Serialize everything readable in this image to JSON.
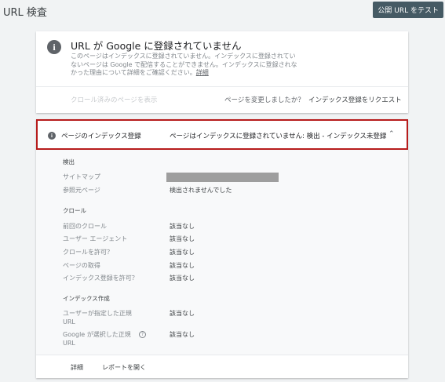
{
  "header": {
    "title": "URL 検査",
    "test_live_url_label": "公開 URL をテスト"
  },
  "status_card": {
    "title": "URL が Google に登録されていません",
    "desc_line1": "このページはインデックスに登録されていません。インデックスに登録されてい",
    "desc_line2": "ないページは Google で配信することができません。インデックスに登録されな",
    "desc_line3": "かった理由について詳細をご確認ください。",
    "details_link": "詳細",
    "view_crawled_page": "クロール済みのページを表示",
    "page_changed_question": "ページを変更しましたか？",
    "request_indexing": "インデックス登録をリクエスト"
  },
  "coverage": {
    "label": "ページのインデックス登録",
    "status": "ページはインデックスに登録されていません: 検出 - インデックス未登録",
    "discovery": {
      "heading": "検出",
      "sitemap_label": "サイトマップ",
      "referring_label": "参照元ページ",
      "referring_value": "検出されませんでした"
    },
    "crawl": {
      "heading": "クロール",
      "rows": [
        {
          "label": "前回のクロール",
          "value": "該当なし"
        },
        {
          "label": "ユーザー エージェント",
          "value": "該当なし"
        },
        {
          "label": "クロールを許可？",
          "value": "該当なし"
        },
        {
          "label": "ページの取得",
          "value": "該当なし"
        },
        {
          "label": "インデックス登録を許可？",
          "value": "該当なし"
        }
      ]
    },
    "indexing": {
      "heading": "インデックス作成",
      "user_canonical_line1": "ユーザーが指定した正規",
      "user_canonical_line2": "URL",
      "user_canonical_value": "該当なし",
      "google_canonical_line1": "Google が選択した正規",
      "google_canonical_line2": "URL",
      "google_canonical_value": "該当なし",
      "help_icon_glyph": "?"
    },
    "footer": {
      "details": "詳細",
      "open_report": "レポートを開く"
    }
  }
}
